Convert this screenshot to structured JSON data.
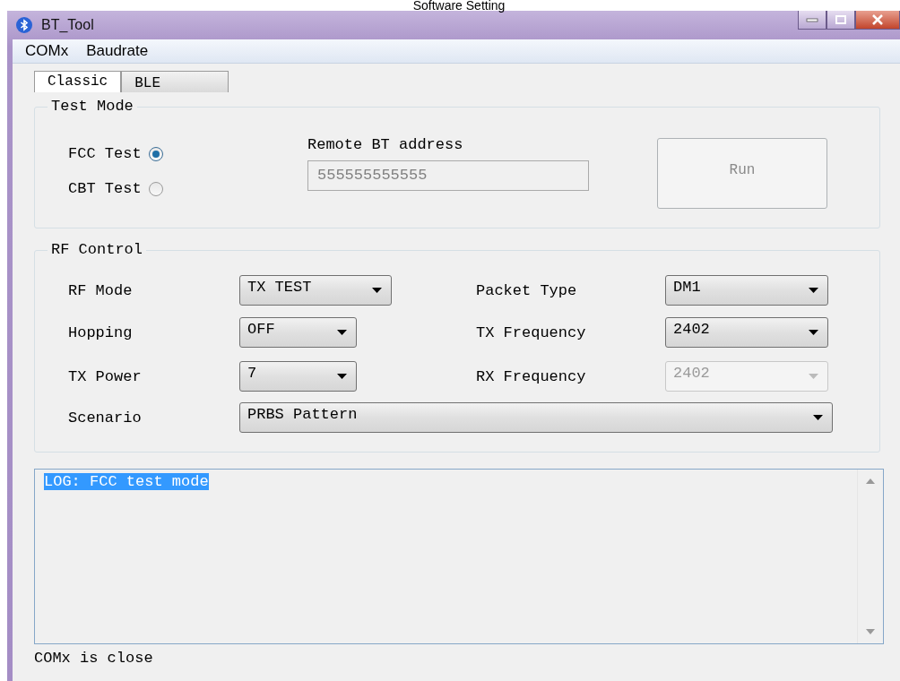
{
  "caption": "Software Setting",
  "window": {
    "title": "BT_Tool"
  },
  "menu": [
    "COMx",
    "Baudrate"
  ],
  "tabs": [
    {
      "label": "Classic",
      "selected": true
    },
    {
      "label": "BLE",
      "selected": false
    }
  ],
  "test_mode": {
    "title": "Test Mode",
    "modes": [
      {
        "label": "FCC Test",
        "selected": true
      },
      {
        "label": "CBT Test",
        "selected": false
      }
    ],
    "address_label": "Remote BT address",
    "address": {
      "value": "555555555555",
      "disabled": true
    },
    "run_button": {
      "label": "Run",
      "disabled": true
    }
  },
  "rf_control": {
    "title": "RF Control",
    "left": [
      {
        "label": "RF Mode",
        "value": "TX TEST",
        "disabled": false
      },
      {
        "label": "Hopping",
        "value": "OFF",
        "disabled": false
      },
      {
        "label": "TX Power",
        "value": "7",
        "disabled": false
      }
    ],
    "right": [
      {
        "label": "Packet Type",
        "value": "DM1",
        "disabled": false
      },
      {
        "label": "TX Frequency",
        "value": "2402",
        "disabled": false
      },
      {
        "label": "RX Frequency",
        "value": "2402",
        "disabled": true
      }
    ],
    "scenario": {
      "label": "Scenario",
      "value": "PRBS Pattern",
      "disabled": false
    }
  },
  "log": [
    {
      "text": "LOG: FCC test mode",
      "selected": true
    }
  ],
  "status": "COMx is close"
}
